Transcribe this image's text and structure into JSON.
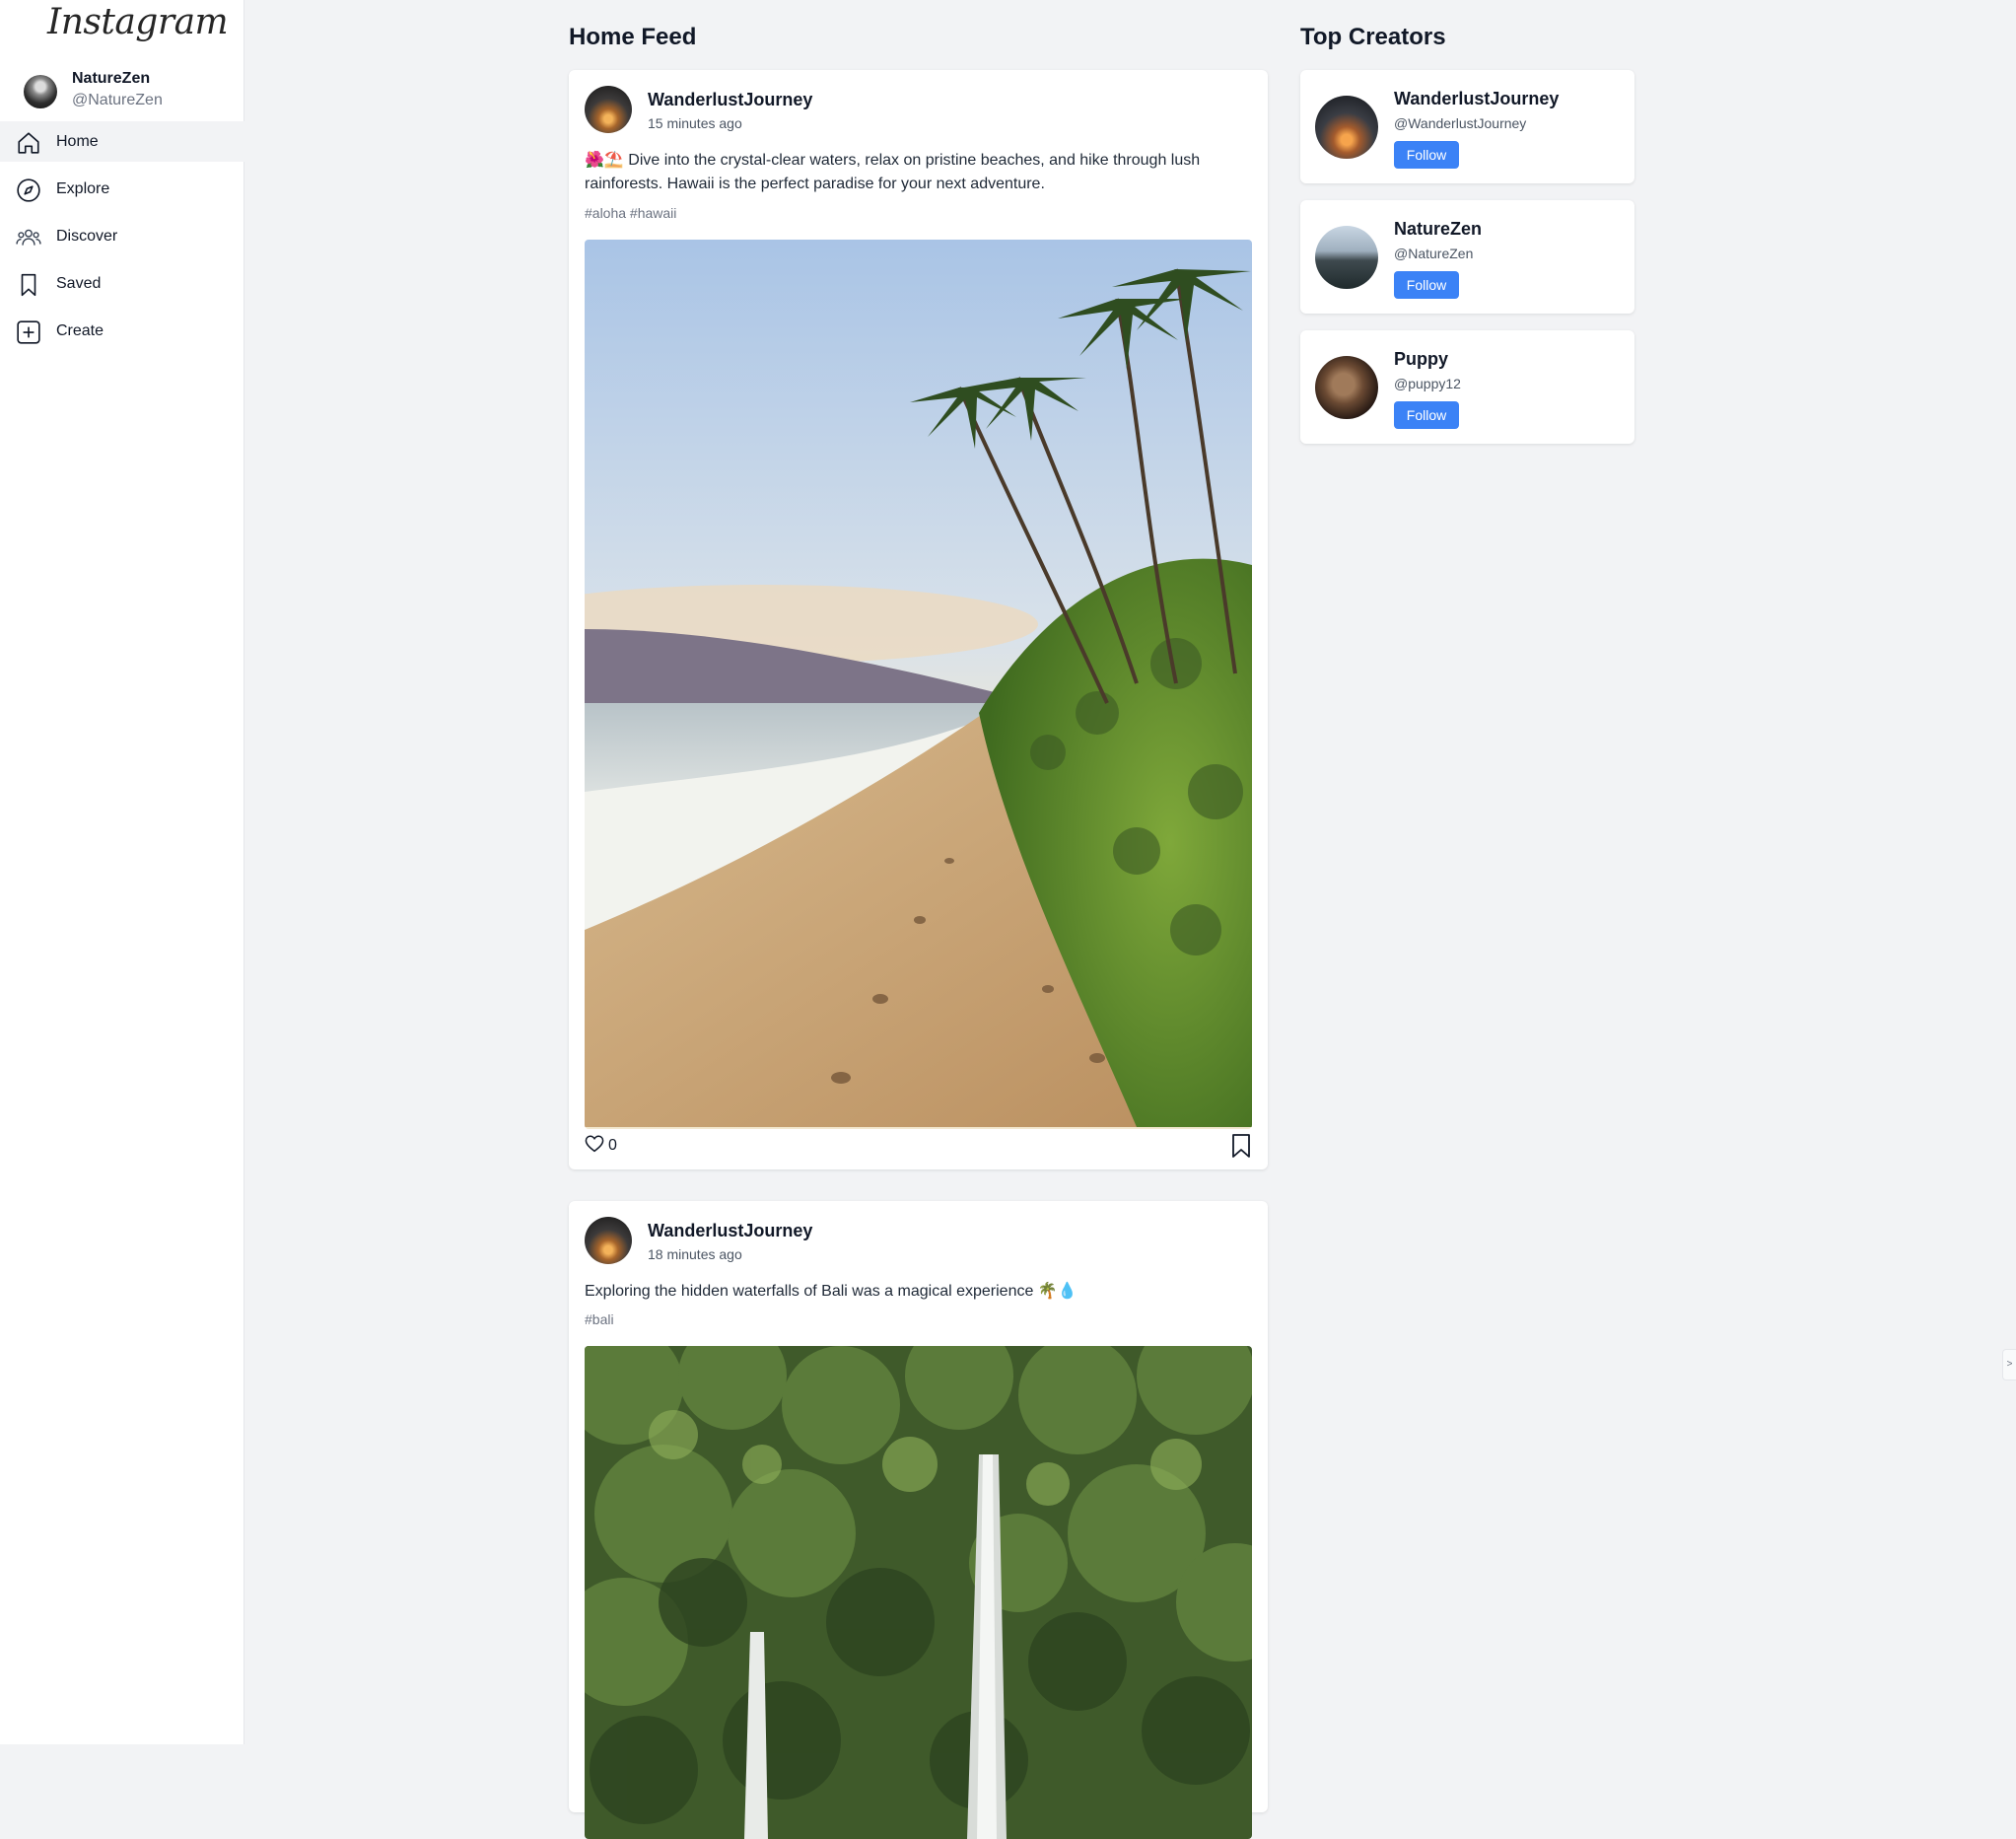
{
  "app": {
    "logo": "Instagram"
  },
  "profile": {
    "name": "NatureZen",
    "handle": "@NatureZen"
  },
  "nav": [
    {
      "label": "Home",
      "icon": "home-icon",
      "active": true
    },
    {
      "label": "Explore",
      "icon": "compass-icon",
      "active": false
    },
    {
      "label": "Discover",
      "icon": "people-icon",
      "active": false
    },
    {
      "label": "Saved",
      "icon": "bookmark-icon",
      "active": false
    },
    {
      "label": "Create",
      "icon": "plus-square-icon",
      "active": false
    }
  ],
  "feed": {
    "title": "Home Feed",
    "posts": [
      {
        "author": "WanderlustJourney",
        "time": "15 minutes ago",
        "caption": "🌺⛱️ Dive into the crystal-clear waters, relax on pristine beaches, and hike through lush rainforests. Hawaii is the perfect paradise for your next adventure.",
        "tags": "#aloha #hawaii",
        "likes": "0"
      },
      {
        "author": "WanderlustJourney",
        "time": "18 minutes ago",
        "caption": "Exploring the hidden waterfalls of Bali was a magical experience 🌴💧",
        "tags": "#bali"
      }
    ]
  },
  "creators": {
    "title": "Top Creators",
    "items": [
      {
        "name": "WanderlustJourney",
        "handle": "@WanderlustJourney",
        "follow": "Follow"
      },
      {
        "name": "NatureZen",
        "handle": "@NatureZen",
        "follow": "Follow"
      },
      {
        "name": "Puppy",
        "handle": "@puppy12",
        "follow": "Follow"
      }
    ]
  },
  "colors": {
    "accent": "#3b82f6",
    "background": "#f2f3f5",
    "card": "#ffffff"
  }
}
